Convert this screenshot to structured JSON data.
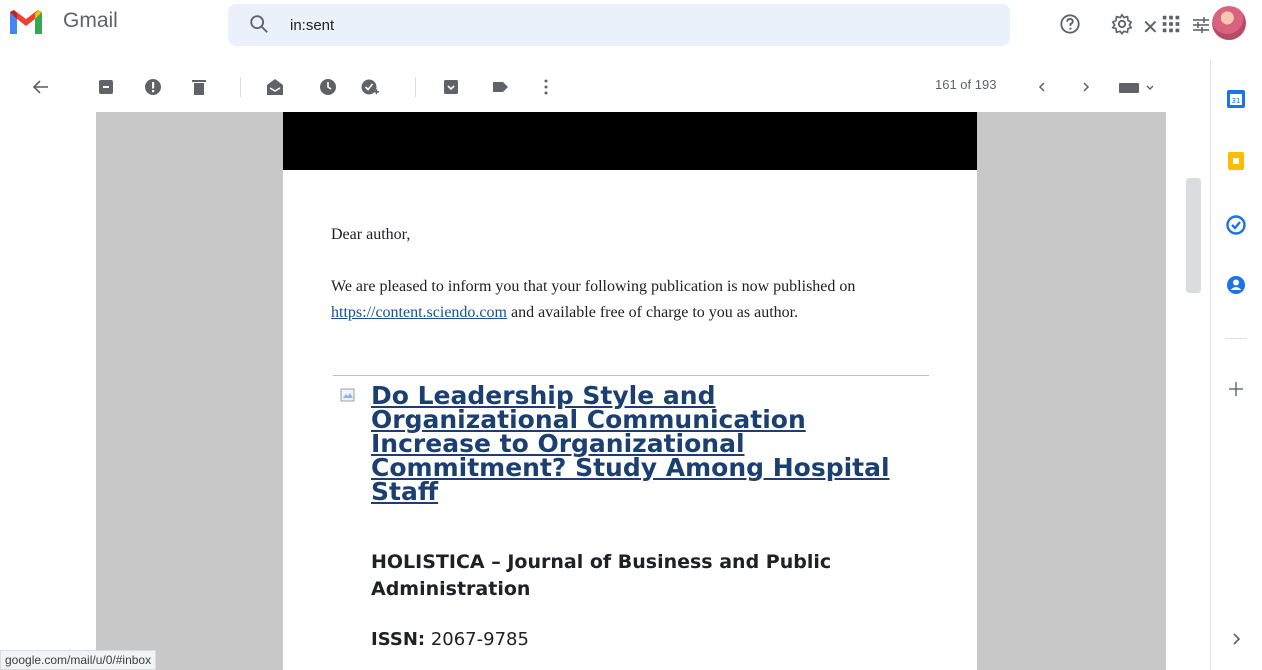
{
  "app": {
    "name": "Gmail"
  },
  "search": {
    "query": "in:sent"
  },
  "toolbar": {
    "pager_text": "161 of 193"
  },
  "email": {
    "greeting": "Dear author,",
    "para_before_link": "We are pleased to inform you that your following publication is now published on ",
    "link_text": "https://content.sciendo.com",
    "para_after_link": " and available free of charge to you as author.",
    "article_title": "Do Leadership Style and Organizational Communication Increase to Organizational Commitment? Study Among Hospital Staff",
    "journal": "HOLISTICA – Journal of Business and Public Administration",
    "issn_label": "ISSN:",
    "issn_value": " 2067-9785"
  },
  "status_bar": {
    "url": "google.com/mail/u/0/#inbox"
  },
  "colors": {
    "accent": "#1a73e8",
    "link": "#1a4fa0",
    "title": "#1c3f72",
    "search_bg": "#eaf1fb"
  }
}
